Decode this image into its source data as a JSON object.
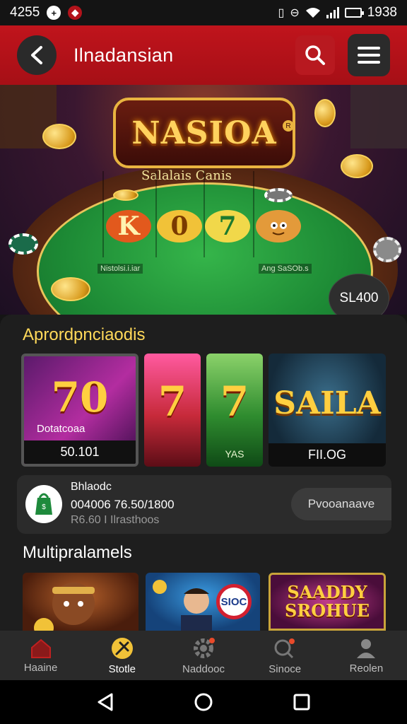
{
  "status_bar": {
    "left_time": "4255",
    "right_time": "1938",
    "icons": [
      "data-saver-icon",
      "app-notification-icon",
      "vibrate-icon",
      "do-not-disturb-icon",
      "wifi-icon",
      "signal-icon",
      "battery-icon"
    ]
  },
  "header": {
    "title": "Ilnadansian",
    "back_icon": "back-arrow-icon",
    "search_icon": "search-icon",
    "menu_icon": "hamburger-menu-icon",
    "accent_color": "#b3131b"
  },
  "hero": {
    "logo_text": "NASIOA",
    "subtitle": "Salalais Canis",
    "reel_symbols": [
      "K",
      "0",
      "7"
    ],
    "felt_left_label": "Nistolsi.i.iar",
    "felt_right_label": "Ang SaSOb.s",
    "bet_bubble": "SL400"
  },
  "section1": {
    "title": "Aprordpnciaodis",
    "cards": [
      {
        "symbol": "70",
        "caption": "Dotatcoaa",
        "label": "50.101"
      },
      {
        "symbol": "7",
        "caption": "",
        "label": ""
      },
      {
        "symbol": "7",
        "caption": "",
        "label": "YAS"
      },
      {
        "symbol": "SAILA",
        "caption": "",
        "label": "FII.OG"
      }
    ],
    "promo": {
      "title": "Bhlaodc",
      "line1": "004006 76.50/1800",
      "line2": "R6.60 I Ilrasthoos",
      "button": "Pvooanaave"
    }
  },
  "section2": {
    "title": "Multipralamels",
    "thumbs": [
      "",
      "SIOC",
      "SAADDY SROHUE"
    ]
  },
  "bottom_nav": [
    {
      "label": "Haaine",
      "icon": "home-icon"
    },
    {
      "label": "Stotle",
      "icon": "slots-icon"
    },
    {
      "label": "Naddooc",
      "icon": "settings-gear-icon"
    },
    {
      "label": "Sinoce",
      "icon": "search-notification-icon"
    },
    {
      "label": "Reolen",
      "icon": "profile-icon"
    }
  ],
  "system_nav": [
    "back-triangle-icon",
    "home-circle-icon",
    "recents-square-icon"
  ]
}
